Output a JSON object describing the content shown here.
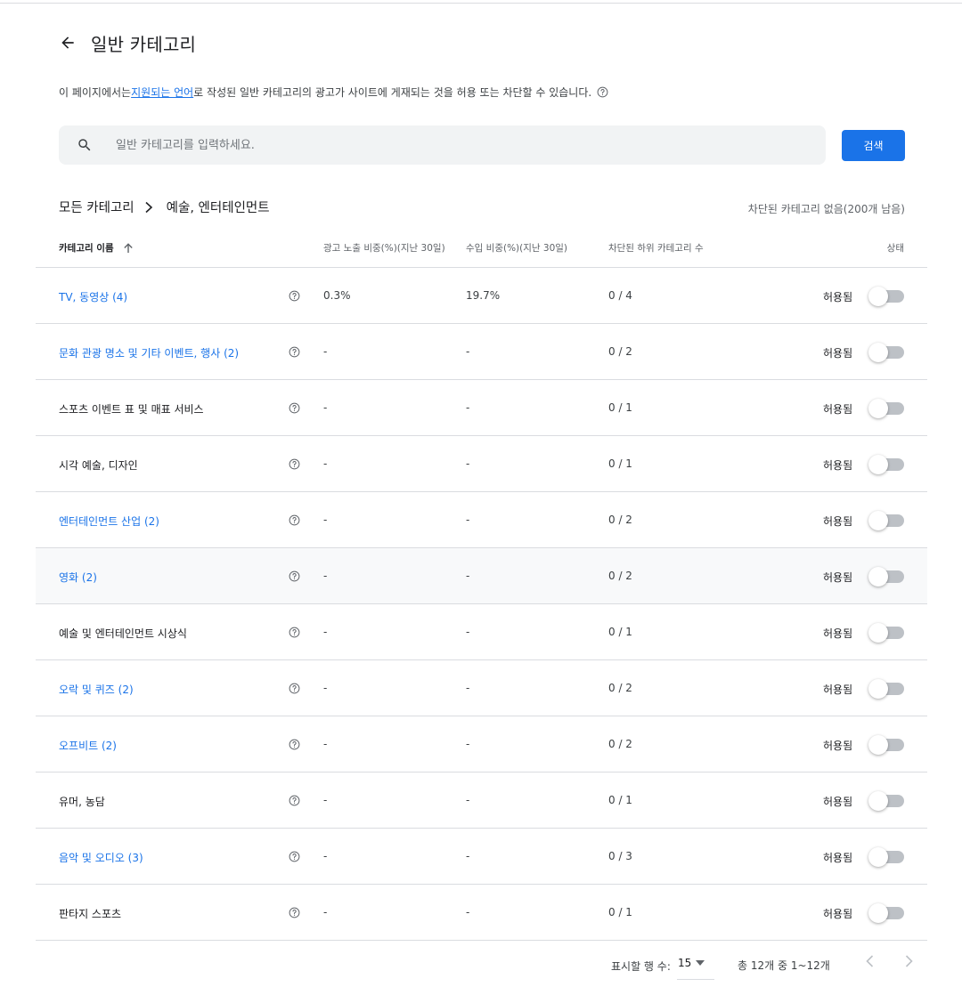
{
  "header": {
    "title": "일반 카테고리"
  },
  "description": {
    "prefix": "이 페이지에서는 ",
    "link": "지원되는 언어",
    "suffix": "로 작성된 일반 카테고리의 광고가 사이트에 게재되는 것을 허용 또는 차단할 수 있습니다."
  },
  "search": {
    "placeholder": "일반 카테고리를 입력하세요.",
    "button": "검색"
  },
  "breadcrumb": {
    "root": "모든 카테고리",
    "current": "예술, 엔터테인먼트"
  },
  "blocked_summary": "차단된 카테고리 없음(200개 남음)",
  "table": {
    "headers": {
      "name": "카테고리 이름",
      "ad_share": "광고 노출 비중(%)(지난 30일)",
      "revenue_share": "수입 비중(%)(지난 30일)",
      "blocked_sub": "차단된 하위 카테고리 수",
      "status": "상태"
    },
    "rows": [
      {
        "name": "TV, 동영상 (4)",
        "ad": "0.3%",
        "rev": "19.7%",
        "blocked": "0 / 4",
        "status": "허용됨"
      },
      {
        "name": "문화 관광 명소 및 기타 이벤트, 행사 (2)",
        "ad": "-",
        "rev": "-",
        "blocked": "0 / 2",
        "status": "허용됨"
      },
      {
        "name": "스포츠 이벤트 표 및 매표 서비스",
        "ad": "-",
        "rev": "-",
        "blocked": "0 / 1",
        "status": "허용됨"
      },
      {
        "name": "시각 예술, 디자인",
        "ad": "-",
        "rev": "-",
        "blocked": "0 / 1",
        "status": "허용됨"
      },
      {
        "name": "엔터테인먼트 산업 (2)",
        "ad": "-",
        "rev": "-",
        "blocked": "0 / 2",
        "status": "허용됨"
      },
      {
        "name": "영화 (2)",
        "ad": "-",
        "rev": "-",
        "blocked": "0 / 2",
        "status": "허용됨"
      },
      {
        "name": "예술 및 엔터테인먼트 시상식",
        "ad": "-",
        "rev": "-",
        "blocked": "0 / 1",
        "status": "허용됨"
      },
      {
        "name": "오락 및 퀴즈 (2)",
        "ad": "-",
        "rev": "-",
        "blocked": "0 / 2",
        "status": "허용됨"
      },
      {
        "name": "오프비트 (2)",
        "ad": "-",
        "rev": "-",
        "blocked": "0 / 2",
        "status": "허용됨"
      },
      {
        "name": "유머, 농담",
        "ad": "-",
        "rev": "-",
        "blocked": "0 / 1",
        "status": "허용됨"
      },
      {
        "name": "음악 및 오디오 (3)",
        "ad": "-",
        "rev": "-",
        "blocked": "0 / 3",
        "status": "허용됨"
      },
      {
        "name": "판타지 스포츠",
        "ad": "-",
        "rev": "-",
        "blocked": "0 / 1",
        "status": "허용됨"
      }
    ]
  },
  "pagination": {
    "rows_label": "표시할 행 수:",
    "rows_value": "15",
    "range": "총 12개 중 1~12개"
  },
  "colors": {
    "accent": "#1a73e8",
    "text": "#202124",
    "muted": "#5f6368",
    "divider": "#dadce0"
  }
}
